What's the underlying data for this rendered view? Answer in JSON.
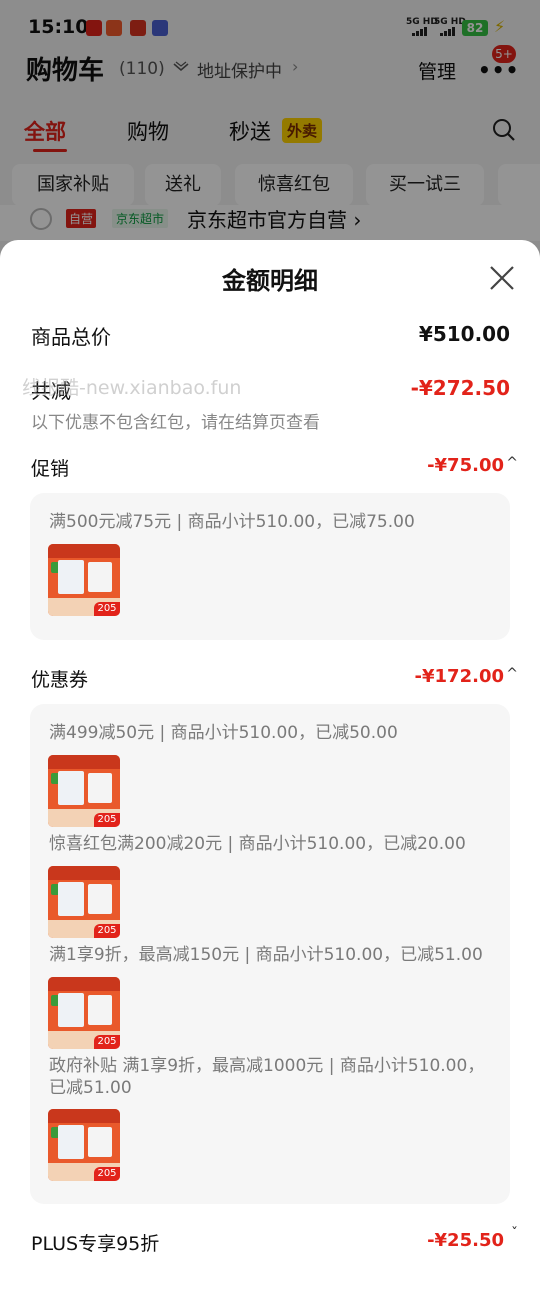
{
  "status_bar": {
    "time": "15:10",
    "signal1": "5G HD",
    "signal2": "5G HD",
    "battery": "82"
  },
  "header": {
    "title": "购物车",
    "count": "(110)",
    "address": "地址保护中",
    "manage": "管理",
    "badge": "5+"
  },
  "tabs": [
    {
      "label": "全部"
    },
    {
      "label": "购物"
    },
    {
      "label": "秒送"
    }
  ],
  "waimai_label": "外卖",
  "chips": [
    "国家补贴",
    "送礼",
    "惊喜红包",
    "买一试三"
  ],
  "shop": {
    "tag_self": "自营",
    "tag_market": "京东超市",
    "name": "京东超市官方自营 ›"
  },
  "sheet": {
    "title": "金额明细",
    "total_label": "商品总价",
    "total_value": "¥510.00",
    "reduce_label": "共减",
    "reduce_value": "-¥272.50",
    "note": "以下优惠不包含红包，请在结算页查看",
    "watermark": "线报酷-new.xianbao.fun",
    "promo": {
      "label": "促销",
      "value": "-¥75.00",
      "items": [
        {
          "text": "满500元减75元 | 商品小计510.00，已减75.00"
        }
      ]
    },
    "coupons": {
      "label": "优惠券",
      "value": "-¥172.00",
      "items": [
        {
          "text": "满499减50元 | 商品小计510.00，已减50.00"
        },
        {
          "text": "惊喜红包满200减20元 | 商品小计510.00，已减20.00"
        },
        {
          "text": "满1享9折，最高减150元 | 商品小计510.00，已减51.00"
        },
        {
          "text_line1": "政府补贴 满1享9折，最高减1000元 | 商品小计510.00，",
          "text_line2": "已减51.00"
        }
      ]
    },
    "plus": {
      "label": "PLUS专享95折",
      "value": "-¥25.50"
    },
    "thumb_price": "205"
  },
  "colors": {
    "accent_red": "#e2231a",
    "muted_text": "#888888"
  }
}
